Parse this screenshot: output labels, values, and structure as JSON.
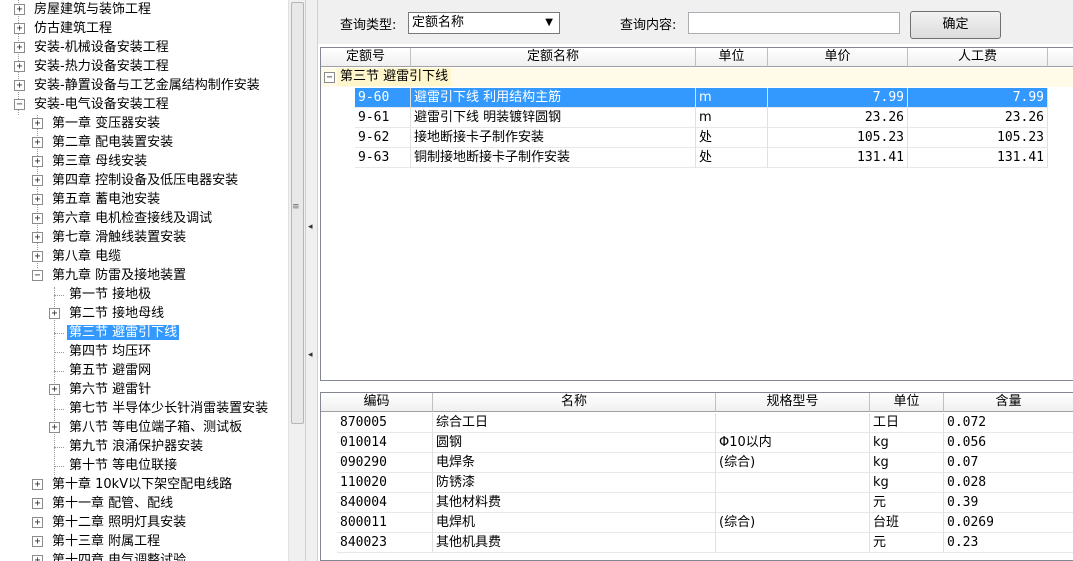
{
  "tree": {
    "items": [
      {
        "label": "房屋建筑与装饰工程",
        "level": 0,
        "expander": "+"
      },
      {
        "label": "仿古建筑工程",
        "level": 0,
        "expander": "+"
      },
      {
        "label": "安装-机械设备安装工程",
        "level": 0,
        "expander": "+"
      },
      {
        "label": "安装-热力设备安装工程",
        "level": 0,
        "expander": "+"
      },
      {
        "label": "安装-静置设备与工艺金属结构制作安装",
        "level": 0,
        "expander": "+"
      },
      {
        "label": "安装-电气设备安装工程",
        "level": 0,
        "expander": "-"
      },
      {
        "label": "第一章 变压器安装",
        "level": 1,
        "expander": "+"
      },
      {
        "label": "第二章 配电装置安装",
        "level": 1,
        "expander": "+"
      },
      {
        "label": "第三章 母线安装",
        "level": 1,
        "expander": "+"
      },
      {
        "label": "第四章 控制设备及低压电器安装",
        "level": 1,
        "expander": "+"
      },
      {
        "label": "第五章 蓄电池安装",
        "level": 1,
        "expander": "+"
      },
      {
        "label": "第六章 电机检查接线及调试",
        "level": 1,
        "expander": "+"
      },
      {
        "label": "第七章 滑触线装置安装",
        "level": 1,
        "expander": "+"
      },
      {
        "label": "第八章 电缆",
        "level": 1,
        "expander": "+"
      },
      {
        "label": "第九章 防雷及接地装置",
        "level": 1,
        "expander": "-"
      },
      {
        "label": "第一节 接地极",
        "level": 2,
        "expander": ""
      },
      {
        "label": "第二节 接地母线",
        "level": 2,
        "expander": "+"
      },
      {
        "label": "第三节 避雷引下线",
        "level": 2,
        "expander": "",
        "selected": true
      },
      {
        "label": "第四节 均压环",
        "level": 2,
        "expander": ""
      },
      {
        "label": "第五节 避雷网",
        "level": 2,
        "expander": ""
      },
      {
        "label": "第六节 避雷针",
        "level": 2,
        "expander": "+"
      },
      {
        "label": "第七节 半导体少长针消雷装置安装",
        "level": 2,
        "expander": ""
      },
      {
        "label": "第八节 等电位端子箱、测试板",
        "level": 2,
        "expander": "+"
      },
      {
        "label": "第九节 浪涌保护器安装",
        "level": 2,
        "expander": ""
      },
      {
        "label": "第十节 等电位联接",
        "level": 2,
        "expander": ""
      },
      {
        "label": "第十章 10kV以下架空配电线路",
        "level": 1,
        "expander": "+"
      },
      {
        "label": "第十一章 配管、配线",
        "level": 1,
        "expander": "+"
      },
      {
        "label": "第十二章 照明灯具安装",
        "level": 1,
        "expander": "+"
      },
      {
        "label": "第十三章 附属工程",
        "level": 1,
        "expander": "+"
      },
      {
        "label": "第十四章 电气调整试验",
        "level": 1,
        "expander": "+"
      }
    ]
  },
  "query": {
    "type_label": "查询类型:",
    "type_value": "定额名称",
    "content_label": "查询内容:",
    "content_value": "",
    "confirm_label": "确定"
  },
  "top_table": {
    "columns": [
      "定额号",
      "定额名称",
      "单位",
      "单价",
      "人工费"
    ],
    "group_label": "第三节 避雷引下线",
    "rows": [
      {
        "code": "9-60",
        "name": "避雷引下线 利用结构主筋",
        "unit": "m",
        "price": "7.99",
        "labor": "7.99",
        "selected": true
      },
      {
        "code": "9-61",
        "name": "避雷引下线 明装镀锌圆钢",
        "unit": "m",
        "price": "23.26",
        "labor": "23.26"
      },
      {
        "code": "9-62",
        "name": "接地断接卡子制作安装",
        "unit": "处",
        "price": "105.23",
        "labor": "105.23"
      },
      {
        "code": "9-63",
        "name": "铜制接地断接卡子制作安装",
        "unit": "处",
        "price": "131.41",
        "labor": "131.41"
      }
    ]
  },
  "bottom_table": {
    "columns": [
      "编码",
      "名称",
      "规格型号",
      "单位",
      "含量"
    ],
    "rows": [
      {
        "code": "870005",
        "name": "综合工日",
        "spec": "",
        "unit": "工日",
        "qty": "0.072"
      },
      {
        "code": "010014",
        "name": "圆钢",
        "spec": "Φ10以内",
        "unit": "kg",
        "qty": "0.056"
      },
      {
        "code": "090290",
        "name": "电焊条",
        "spec": "(综合)",
        "unit": "kg",
        "qty": "0.07"
      },
      {
        "code": "110020",
        "name": "防锈漆",
        "spec": "",
        "unit": "kg",
        "qty": "0.028"
      },
      {
        "code": "840004",
        "name": "其他材料费",
        "spec": "",
        "unit": "元",
        "qty": "0.39"
      },
      {
        "code": "800011",
        "name": "电焊机",
        "spec": "(综合)",
        "unit": "台班",
        "qty": "0.0269"
      },
      {
        "code": "840023",
        "name": "其他机具费",
        "spec": "",
        "unit": "元",
        "qty": "0.23"
      }
    ]
  }
}
